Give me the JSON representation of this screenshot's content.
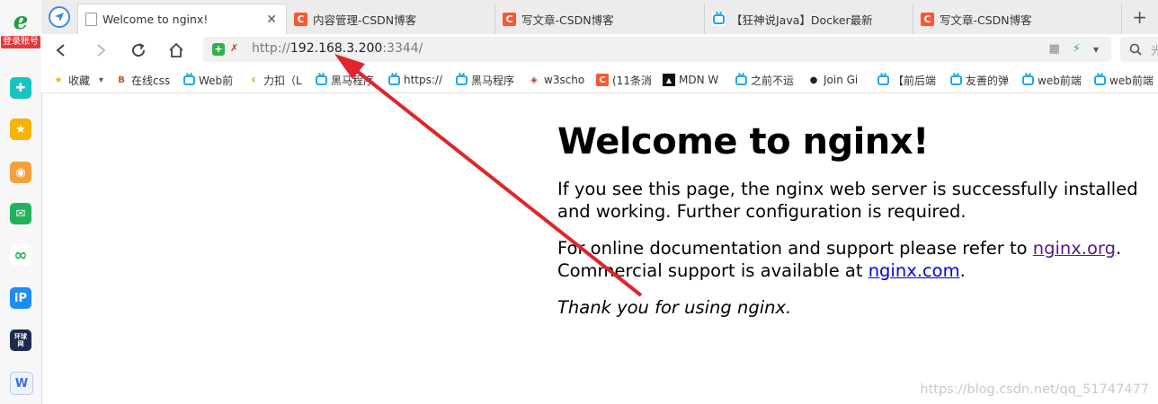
{
  "sidebar": {
    "login_label": "登录账号",
    "items": [
      {
        "icon": "plus-cross-icon",
        "color": "#19c4c0",
        "glyph": "✚"
      },
      {
        "icon": "star-icon",
        "color": "#f5b400",
        "glyph": "★"
      },
      {
        "icon": "weibo-icon",
        "color": "#f3a03a",
        "glyph": "◉"
      },
      {
        "icon": "mail-icon",
        "color": "#21b35a",
        "glyph": "✉"
      },
      {
        "icon": "loop-icon",
        "color": "#ffffff",
        "glyph": "∞"
      },
      {
        "icon": "ip-app-icon",
        "color": "#1e8cf0",
        "glyph": "iP"
      },
      {
        "icon": "huanqiu-icon",
        "color": "#1d2b4f",
        "glyph": "环球网"
      },
      {
        "icon": "word-doc-icon",
        "color": "#3b6fd8",
        "glyph": "W"
      }
    ]
  },
  "tabs": [
    {
      "title": "Welcome to nginx!",
      "icon": "page-icon",
      "active": true
    },
    {
      "title": "内容管理-CSDN博客",
      "icon": "csdn-icon",
      "active": false
    },
    {
      "title": "写文章-CSDN博客",
      "icon": "csdn-icon",
      "active": false
    },
    {
      "title": "【狂神说Java】Docker最新",
      "icon": "bilibili-icon",
      "active": false
    },
    {
      "title": "写文章-CSDN博客",
      "icon": "csdn-icon",
      "active": false
    }
  ],
  "address": {
    "scheme": "http://",
    "host": "192.168.3.200",
    "port": ":3344/",
    "search_glyph": "光"
  },
  "bookmarks": [
    {
      "label": "收藏",
      "icon": "star-icon"
    },
    {
      "label": "在线css",
      "icon": "bookmark-b-icon"
    },
    {
      "label": "Web前",
      "icon": "bilibili-icon"
    },
    {
      "label": "力扣（L",
      "icon": "leetcode-icon"
    },
    {
      "label": "黑马程序",
      "icon": "bilibili-icon"
    },
    {
      "label": "https://",
      "icon": "bilibili-icon"
    },
    {
      "label": "黑马程序",
      "icon": "bilibili-icon"
    },
    {
      "label": "w3scho",
      "icon": "w3school-icon"
    },
    {
      "label": "(11条消",
      "icon": "csdn-icon"
    },
    {
      "label": "MDN W",
      "icon": "mdn-icon"
    },
    {
      "label": "之前不运",
      "icon": "bilibili-icon"
    },
    {
      "label": "Join Gi",
      "icon": "github-icon"
    },
    {
      "label": "【前后端",
      "icon": "bilibili-icon"
    },
    {
      "label": "友善的弹",
      "icon": "bilibili-icon"
    },
    {
      "label": "web前端",
      "icon": "bilibili-icon"
    },
    {
      "label": "web前端",
      "icon": "bilibili-icon"
    }
  ],
  "page": {
    "heading": "Welcome to nginx!",
    "para1": "If you see this page, the nginx web server is successfully installed and working. Further configuration is required.",
    "para2_prefix": "For online documentation and support please refer to ",
    "link1": "nginx.org",
    "para2_mid": ".",
    "para2_line2": "Commercial support is available at ",
    "link2": "nginx.com",
    "para2_end": ".",
    "para3": "Thank you for using nginx."
  },
  "watermark": "https://blog.csdn.net/qq_51747477",
  "colors": {
    "annotation_arrow": "#e0252b",
    "link": "#0000ee",
    "visited_link": "#551a8b"
  }
}
